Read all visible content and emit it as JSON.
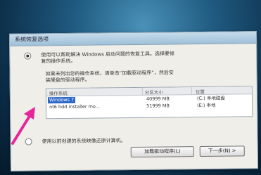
{
  "dialog": {
    "title": "系统恢复选项",
    "option1_line1": "使用可以帮助解决 Windows 启动问题的恢复工具。选择要修",
    "option1_line2": "复的操作系统。",
    "info_line1": "如果未列出您的操作系统，请单击“加载驱动程序”，然后安",
    "info_line2": "装硬盘的驱动程序。",
    "table": {
      "headers": [
        "操作系统",
        "分区大小",
        "位置"
      ],
      "rows": [
        {
          "os": "Windows 7",
          "size": "40999 MB",
          "location": "(C:) 本地磁盘"
        },
        {
          "os": "nt6 hdd installer mo...",
          "size": "51999 MB",
          "location": "(E:) 本地"
        }
      ]
    },
    "option2": "使用以前创建的系统映像还原计算机。",
    "load_driver_button": "加载驱动程序(L)",
    "next_button": "下一步(N) >"
  },
  "colors": {
    "arrow": "#e8249a",
    "selection": "#2d67c7"
  }
}
